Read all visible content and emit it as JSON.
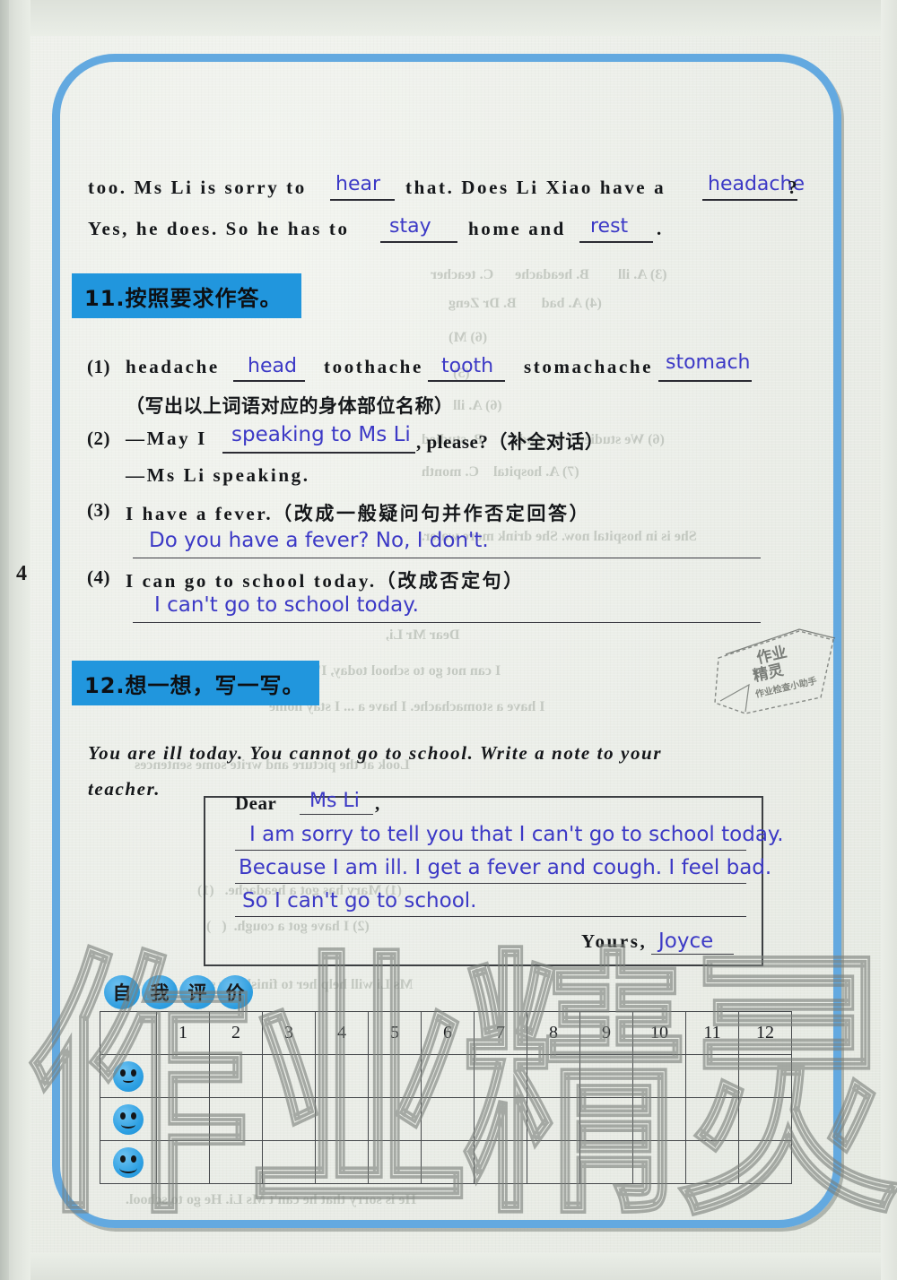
{
  "page": {
    "page_number": "4",
    "accent_blue": "#2196dd",
    "frame_blue": "#63a9e0",
    "ink_blue": "#3c39c6",
    "watermark_text": "作业精灵"
  },
  "carryover_paragraph": {
    "line1_a": "too. Ms Li is sorry to",
    "answer1": "hear",
    "line1_b": "that. Does Li Xiao have a",
    "answer2": "headache",
    "line1_c": "?",
    "line2_a": "Yes, he does. So he has to",
    "answer3": "stay",
    "line2_b": "home and",
    "answer4": "rest",
    "line2_c": "."
  },
  "exercise11": {
    "header": "11.按照要求作答。",
    "q1": {
      "label": "(1)",
      "word1": "headache",
      "answer1": "head",
      "word2": "toothache",
      "answer2": "tooth",
      "word3": "stomachache",
      "answer3": "stomach",
      "instruction": "（写出以上词语对应的身体部位名称）"
    },
    "q2": {
      "label": "(2)",
      "prompt_a": "—May I",
      "answer": "speaking to Ms Li",
      "prompt_b": ", please?（补全对话）",
      "reply": "—Ms Li speaking."
    },
    "q3": {
      "label": "(3)",
      "prompt": "I have a fever.（改成一般疑问句并作否定回答）",
      "answer": "Do you have  a fever? No, I don't."
    },
    "q4": {
      "label": "(4)",
      "prompt": "I can go to school today.（改成否定句）",
      "answer": "I can't go to school today."
    }
  },
  "exercise12": {
    "header": "12.想一想，写一写。",
    "instruction_line1": "You are ill today. You cannot go to school. Write a note to your",
    "instruction_line2": "teacher.",
    "note": {
      "salutation": "Dear",
      "recipient": "Ms Li",
      "comma": ",",
      "body_line1": "I am sorry to tell you that I can't go to school today.",
      "body_line2": "Because I am ill. I get a fever and cough. I feel bad.",
      "body_line3": "So I can't go to school.",
      "closing": "Yours,",
      "signature": "Joyce"
    }
  },
  "self_evaluation": {
    "title_chars": [
      "自",
      "我",
      "评",
      "价"
    ],
    "columns": [
      "1",
      "2",
      "3",
      "4",
      "5",
      "6",
      "7",
      "8",
      "9",
      "10",
      "11",
      "12"
    ],
    "rows": [
      {
        "icon": "smiley-face-small-smile"
      },
      {
        "icon": "smiley-face-medium-smile"
      },
      {
        "icon": "smiley-face-big-smile"
      }
    ]
  },
  "stamp": {
    "main_text": "作业精灵",
    "sub_text": "作业检查小助手"
  },
  "bleed_text": {
    "b1": "(3) A. ill        B. headache      C. teacher",
    "b2": "(4) A. bad       B. Dr Zeng",
    "b3": "(5)",
    "b4": "(6) M)",
    "b5": "(6) A. ill",
    "b6": "(6) We studied    B. study        B. studied",
    "b7": "(7) A. hospital    C. month",
    "b8": "Dear Mr Li,",
    "b9": "I can not go to school today, I'm sorry",
    "b10": "I have a stomachache. I have a ... I stay home",
    "b11": "Look at the picture and write some sentences",
    "b12": "(1) Mary has got a headache.   (1)",
    "b13": "(2) I have got a cough.  (   )",
    "b14": "Ms Li will help her to finish her study.",
    "b15": "He is sorry that he can't Ms Li. He go to school.",
    "b16": "She is in hospital now. She drink more water."
  }
}
